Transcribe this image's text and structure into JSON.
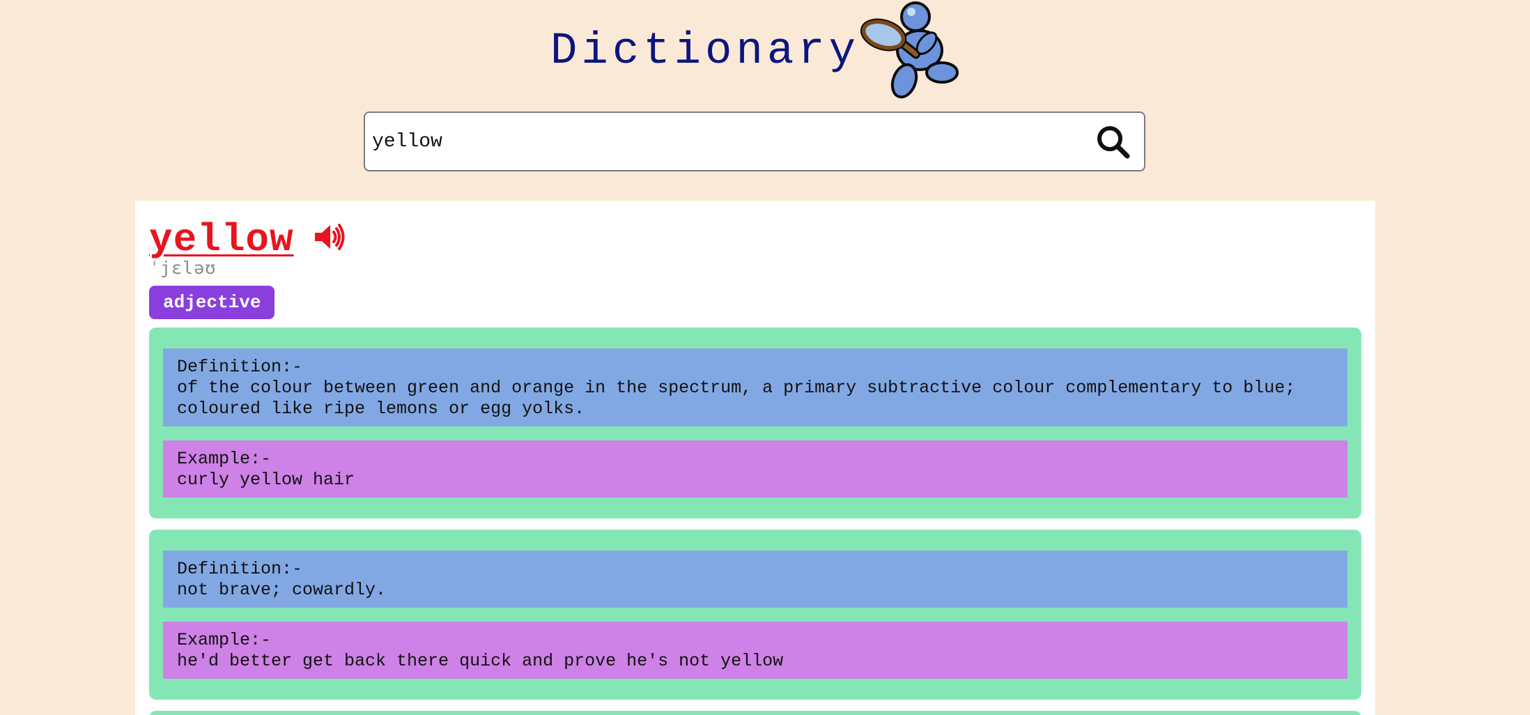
{
  "header": {
    "title": "Dictionary",
    "mascot_icon": "detective-magnifier-mascot-icon"
  },
  "search": {
    "value": "yellow",
    "button_icon": "search-icon"
  },
  "entry": {
    "word": "yellow",
    "audio_icon": "speaker-icon",
    "phonetic": "ˈjɛləʊ",
    "part_of_speech": "adjective",
    "meanings": [
      {
        "definition_label": "Definition:-",
        "definition": "of the colour between green and orange in the spectrum, a primary subtractive colour complementary to blue; coloured like ripe lemons or egg yolks.",
        "example_label": "Example:-",
        "example": "curly yellow hair"
      },
      {
        "definition_label": "Definition:-",
        "definition": "not brave; cowardly.",
        "example_label": "Example:-",
        "example": "he'd better get back there quick and prove he's not yellow"
      }
    ]
  },
  "colors": {
    "page_bg": "#fae9d6",
    "title": "#0b1580",
    "word": "#e8141e",
    "badge": "#8a3fdc",
    "meaning_card": "#85e6b5",
    "definition_bg": "#82a8e3",
    "example_bg": "#ce81e6"
  }
}
